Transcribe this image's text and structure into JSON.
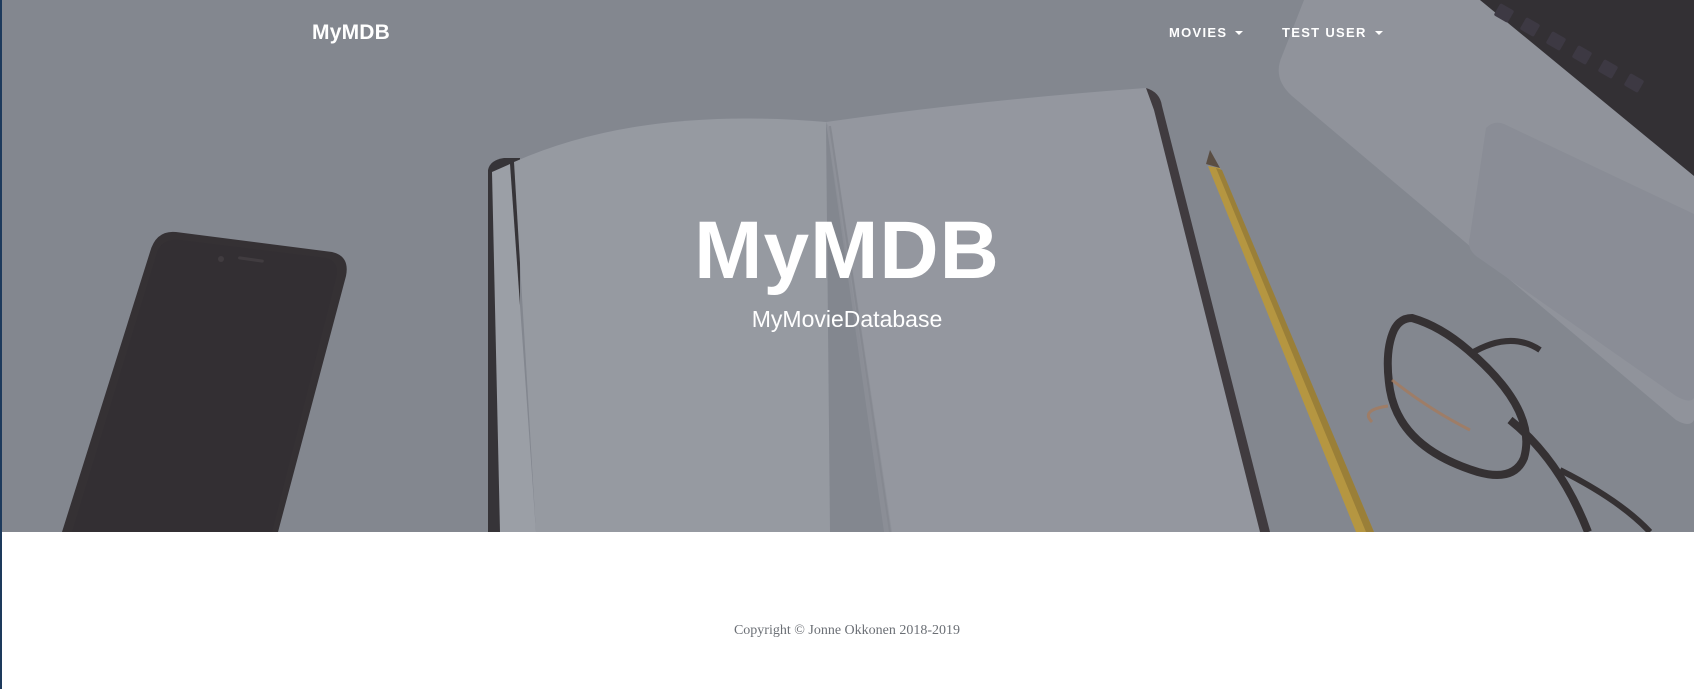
{
  "navbar": {
    "brand": "MyMDB",
    "items": [
      {
        "label": "Movies"
      },
      {
        "label": "Test User"
      }
    ]
  },
  "hero": {
    "heading": "MyMDB",
    "subheading": "MyMovieDatabase"
  },
  "footer": {
    "copyright": "Copyright © Jonne Okkonen 2018-2019"
  },
  "colors": {
    "overlay": "#868991",
    "text_light": "#ffffff",
    "footer_text": "#6b6f75",
    "background": "#ffffff"
  }
}
